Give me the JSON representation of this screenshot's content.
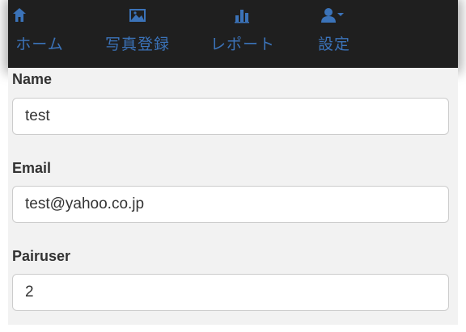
{
  "nav": {
    "items": [
      {
        "label": "ホーム",
        "icon": "home-icon"
      },
      {
        "label": "写真登録",
        "icon": "picture-icon"
      },
      {
        "label": "レポート",
        "icon": "bar-chart-icon"
      },
      {
        "label": "設定",
        "icon": "user-icon"
      }
    ],
    "colors": {
      "background": "#1f1f1f",
      "link": "#3b73b9"
    }
  },
  "form": {
    "name": {
      "label": "Name",
      "value": "test"
    },
    "email": {
      "label": "Email",
      "value": "test@yahoo.co.jp"
    },
    "pairuser": {
      "label": "Pairuser",
      "value": "2"
    }
  }
}
